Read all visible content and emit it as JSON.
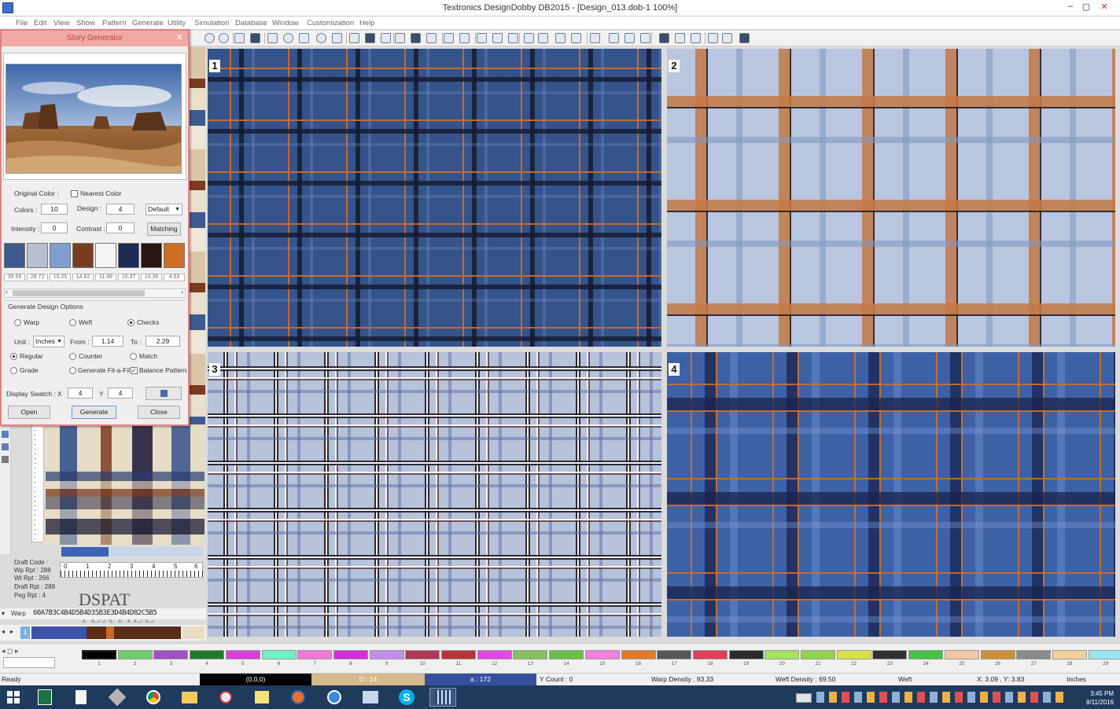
{
  "window": {
    "title": "Textronics DesignDobby DB2015 - [Design_013.dob-1 100%]",
    "controls": [
      "–",
      "▢",
      "✕"
    ]
  },
  "menu": [
    "File",
    "Edit",
    "View",
    "Show",
    "Pattern",
    "Generate",
    "Utility",
    "Simulation",
    "Database",
    "Window",
    "Customization",
    "Help"
  ],
  "dialog": {
    "title": "Story Generator",
    "close": "✕",
    "original_color_label": "Original Color :",
    "nearest_color_label": "Nearest Color",
    "nearest_color_checked": false,
    "colors_label": "Colors :",
    "colors_value": "10",
    "design_label": "Design :",
    "design_value": "4",
    "mode_value": "Default",
    "intensity_label": "Intensity :",
    "intensity_value": "0",
    "contrast_label": "Contrast :",
    "contrast_value": "0",
    "matching_button": "Matching",
    "swatches": [
      {
        "color": "#3f5a8e",
        "value": "39.59"
      },
      {
        "color": "#b8bfcf",
        "value": "28.72"
      },
      {
        "color": "#7e9fd0",
        "value": "15.25"
      },
      {
        "color": "#7a3c20",
        "value": "14.62"
      },
      {
        "color": "#f4f4f4",
        "value": "11.99"
      },
      {
        "color": "#1d2a55",
        "value": "10.37"
      },
      {
        "color": "#281410",
        "value": "10.35"
      },
      {
        "color": "#cc6d28",
        "value": "4.53"
      }
    ],
    "generate_options_label": "Generate Design Options",
    "warp_label": "Warp",
    "weft_label": "Weft",
    "checks_label": "Checks",
    "unit_label": "Unit :",
    "unit_value": "Inches",
    "from_label": "From :",
    "from_value": "1.14",
    "to_label": "To :",
    "to_value": "2.29",
    "regular_label": "Regular",
    "counter_label": "Counter",
    "match_label": "Match",
    "grade_label": "Grade",
    "fil_label": "Generate Fil-a-Fil",
    "balance_label": "Balance Pattern",
    "balance_checked": true,
    "display_swatch_label": "Display Swatch :",
    "x_label": "X",
    "x_value": "4",
    "y_label": "Y",
    "y_value": "4",
    "open_button": "Open",
    "generate_button": "Generate",
    "close_button": "Close"
  },
  "left_info": {
    "draft_code": "Draft Code :",
    "wp_rpt": "Wp Rpt : 288",
    "wt_rpt": "Wt Rpt : 266",
    "draft_rpt": "Draft Rpt : 288",
    "peg_rpt": "Peg Rpt : 4",
    "warp_label": "Warp",
    "warp_code": "60A7B3C4B4D5B4D35B3E3D4B4D82C5B5",
    "ruler_ticks": [
      "0",
      "1",
      "2",
      "3",
      "4",
      "5",
      "6"
    ],
    "seq_marker": "1"
  },
  "watermark": {
    "line1": "DSPAT",
    "line2": "TEXTILE"
  },
  "panels": [
    {
      "id": "p1",
      "label": "1",
      "pattern": "navy plaid with orange and black stripes"
    },
    {
      "id": "p2",
      "label": "2",
      "pattern": "light blue check with rust bands"
    },
    {
      "id": "p3",
      "label": "3",
      "pattern": "grey-blue glen check with black and white lines"
    },
    {
      "id": "p4",
      "label": "4",
      "pattern": "blue plaid with navy bands and orange lines"
    }
  ],
  "palette": {
    "nav": "◂ ◻ ▸",
    "cells": [
      {
        "n": "1",
        "c": "#000000"
      },
      {
        "n": "2",
        "c": "#6fcf6f"
      },
      {
        "n": "3",
        "c": "#a050c0"
      },
      {
        "n": "4",
        "c": "#1e7a2a"
      },
      {
        "n": "5",
        "c": "#d642d6"
      },
      {
        "n": "6",
        "c": "#6ff0c8"
      },
      {
        "n": "7",
        "c": "#f07ad8"
      },
      {
        "n": "8",
        "c": "#d030d8"
      },
      {
        "n": "9",
        "c": "#c090e8"
      },
      {
        "n": "10",
        "c": "#b03a56"
      },
      {
        "n": "11",
        "c": "#b6343c"
      },
      {
        "n": "12",
        "c": "#e04ae0"
      },
      {
        "n": "13",
        "c": "#88c060"
      },
      {
        "n": "14",
        "c": "#6abf4a"
      },
      {
        "n": "15",
        "c": "#f080e0"
      },
      {
        "n": "16",
        "c": "#e07a28"
      },
      {
        "n": "17",
        "c": "#575757"
      },
      {
        "n": "18",
        "c": "#e0405a"
      },
      {
        "n": "19",
        "c": "#2a2a2a"
      },
      {
        "n": "20",
        "c": "#a8e060"
      },
      {
        "n": "21",
        "c": "#9ad050"
      },
      {
        "n": "22",
        "c": "#d6e24a"
      },
      {
        "n": "23",
        "c": "#303030"
      },
      {
        "n": "24",
        "c": "#48c04a"
      },
      {
        "n": "25",
        "c": "#f2c8a8"
      },
      {
        "n": "26",
        "c": "#c9923a"
      },
      {
        "n": "27",
        "c": "#8a8a8a"
      },
      {
        "n": "28",
        "c": "#f2d09a"
      },
      {
        "n": "29",
        "c": "#9ae6f0"
      }
    ]
  },
  "status": {
    "ready": "Ready",
    "coords": "(0,0,0)",
    "d": "D : 14",
    "a": "a : 172",
    "ycount": "Y Count : 0",
    "warp_density": "Warp Density : 93.33",
    "weft_density": "Weft Density : 69.50",
    "weft": "Weft",
    "xy": "X: 3.09 , Y: 3.83",
    "units": "Inches"
  },
  "taskbar": {
    "time": "3:45 PM",
    "date": "8/11/2016"
  },
  "colors": {
    "navy": "#2f4f8a",
    "orange": "#d06a28",
    "dialog_title_bg": "#f2a9a4",
    "taskbar": "#1f3a5c"
  }
}
